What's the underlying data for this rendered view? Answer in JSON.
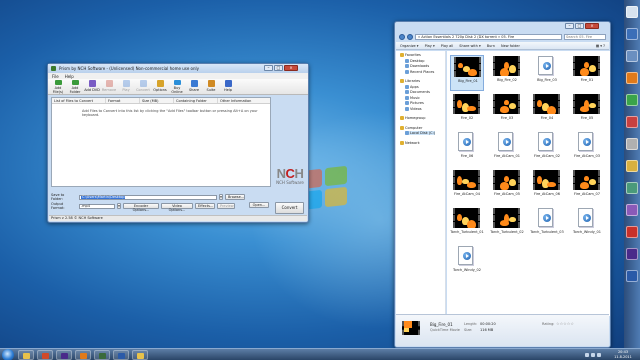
{
  "colors": {
    "accent": "#3875d7",
    "selection": "#cce3f7",
    "nch_red": "#c22020",
    "fire": "#ff8a1a"
  },
  "prism": {
    "title": "Prism by NCH Software - (Unlicensed) Non-commercial home use only",
    "menu": [
      "File",
      "Help"
    ],
    "toolbar": [
      {
        "label": "Add File(s)",
        "icon": "add-file-icon",
        "enabled": true
      },
      {
        "label": "Add Folder",
        "icon": "add-folder-icon",
        "enabled": true
      },
      {
        "label": "Add DVD",
        "icon": "dvd-icon",
        "enabled": true
      },
      {
        "label": "Remove",
        "icon": "remove-icon",
        "enabled": false
      },
      {
        "label": "Play",
        "icon": "play-icon",
        "enabled": false
      },
      {
        "label": "Convert",
        "icon": "convert-icon",
        "enabled": false
      },
      {
        "label": "Options",
        "icon": "options-icon",
        "enabled": true
      },
      {
        "label": "Buy Online",
        "icon": "buy-online-icon",
        "enabled": true
      },
      {
        "label": "Share",
        "icon": "share-icon",
        "enabled": true
      },
      {
        "label": "Suite",
        "icon": "suite-icon",
        "enabled": true
      },
      {
        "label": "Help",
        "icon": "help-icon",
        "enabled": true
      }
    ],
    "columns": [
      "List of Files to Convert",
      "Format",
      "Size (MB)",
      "Containing Folder",
      "Other Information"
    ],
    "empty_hint": "Add Files to Convert into this list by clicking the \"Add Files\" toolbar button or pressing Alt+A on your keyboard.",
    "save_label": "Save to Folder:",
    "save_value": "C:\\Users\\Martin\\Desktop",
    "browse": "Browse...",
    "format_label": "Output Format:",
    "format_value": ".mp4",
    "encoder_options": "Encoder Options...",
    "video_options": "Video Options...",
    "effects": "Effects...",
    "preview": "Preview",
    "open": "Open...",
    "convert": "Convert",
    "status": "Prism v 2.58 © NCH Software",
    "logo_text": "NCH",
    "logo_sub": "NCH Software"
  },
  "explorer": {
    "path": "« Action Essentials 2 720p Disk 2 (DX torrent » 05. Fire",
    "search_placeholder": "Search 05. Fire",
    "commands": [
      "Organize ▾",
      "Play ▾",
      "Play all",
      "Share with ▾",
      "Burn",
      "New folder"
    ],
    "nav": [
      {
        "label": "Favorites",
        "level": 0
      },
      {
        "label": "Desktop",
        "level": 1
      },
      {
        "label": "Downloads",
        "level": 1
      },
      {
        "label": "Recent Places",
        "level": 1
      },
      {
        "label": "Libraries",
        "level": 0
      },
      {
        "label": "Apps",
        "level": 1
      },
      {
        "label": "Documents",
        "level": 1
      },
      {
        "label": "Music",
        "level": 1
      },
      {
        "label": "Pictures",
        "level": 1
      },
      {
        "label": "Videos",
        "level": 1
      },
      {
        "label": "Homegroup",
        "level": 0
      },
      {
        "label": "Computer",
        "level": 0
      },
      {
        "label": "Local Disk (C:)",
        "level": 1
      },
      {
        "label": "Network",
        "level": 0
      }
    ],
    "files": [
      {
        "name": "Big_Fire_01",
        "kind": "video"
      },
      {
        "name": "Big_Fire_02",
        "kind": "video"
      },
      {
        "name": "Big_Fire_03",
        "kind": "doc"
      },
      {
        "name": "Fire_01",
        "kind": "video"
      },
      {
        "name": "Fire_02",
        "kind": "video"
      },
      {
        "name": "Fire_03",
        "kind": "video"
      },
      {
        "name": "Fire_04",
        "kind": "video"
      },
      {
        "name": "Fire_05",
        "kind": "video"
      },
      {
        "name": "Fire_06",
        "kind": "doc"
      },
      {
        "name": "Fire_AtCam_01",
        "kind": "doc"
      },
      {
        "name": "Fire_AtCam_02",
        "kind": "doc"
      },
      {
        "name": "Fire_AtCam_03",
        "kind": "doc"
      },
      {
        "name": "Fire_AtCam_04",
        "kind": "video"
      },
      {
        "name": "Fire_AtCam_05",
        "kind": "video"
      },
      {
        "name": "Fire_AtCam_06",
        "kind": "video"
      },
      {
        "name": "Fire_AtCam_07",
        "kind": "video"
      },
      {
        "name": "Torch_Turbulent_01",
        "kind": "video"
      },
      {
        "name": "Torch_Turbulent_02",
        "kind": "video"
      },
      {
        "name": "Torch_Turbulent_03",
        "kind": "doc"
      },
      {
        "name": "Torch_Windy_01",
        "kind": "doc"
      },
      {
        "name": "Torch_Windy_02",
        "kind": "doc"
      }
    ],
    "selected_index": 0,
    "details": {
      "name": "Big_Fire_01",
      "type": "QuickTime Movie",
      "length_label": "Length:",
      "length": "00:00:20",
      "size_label": "Size:",
      "size": "116 MB",
      "rating_label": "Rating:",
      "stars": "☆☆☆☆☆"
    }
  },
  "taskbar": {
    "time": "20:43",
    "date": "11.8.2011",
    "apps": [
      "explorer-icon",
      "media-player-icon",
      "after-effects-icon",
      "firefox-icon",
      "nch-prism-icon",
      "photoshop-icon",
      "folder-icon"
    ]
  },
  "dock": {
    "items": [
      "clock-widget-icon",
      "network-icon",
      "utility-icon",
      "app-icon-1",
      "app-icon-2",
      "app-icon-3",
      "app-icon-4",
      "app-icon-5",
      "app-icon-6",
      "app-icon-7",
      "adobe-icon",
      "after-effects-icon",
      "photoshop-icon"
    ]
  }
}
